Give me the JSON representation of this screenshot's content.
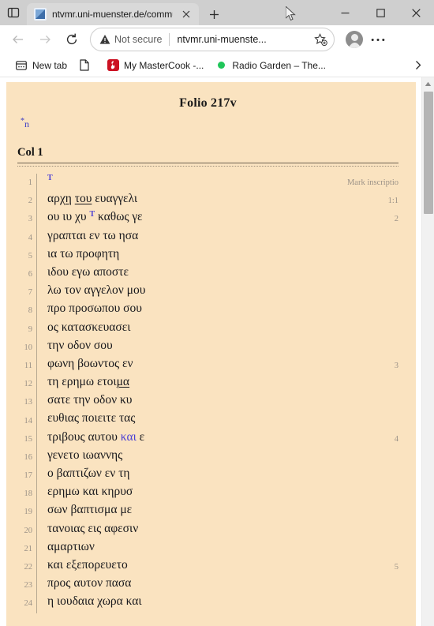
{
  "window": {
    "minimize_label": "Minimize",
    "maximize_label": "Maximize",
    "close_label": "Close"
  },
  "tabstrip": {
    "tab_search_name": "tab-search",
    "tabs": [
      {
        "title": "ntvmr.uni-muenster.de/commun",
        "favicon": "page-icon",
        "close_label": "Close tab"
      }
    ],
    "new_tab_label": "New tab"
  },
  "toolbar": {
    "back_label": "Back",
    "forward_label": "Forward",
    "reload_label": "Refresh",
    "security_text": "Not secure",
    "url": "ntvmr.uni-muenste...",
    "favorite_label": "Add this page to favorites",
    "profile_label": "Profile",
    "settings_label": "Settings and more"
  },
  "bookmarks": {
    "items": [
      {
        "label": "New tab",
        "icon": "new-tab-icon"
      },
      {
        "label": "",
        "icon": "blank-page-icon"
      },
      {
        "label": "My MasterCook -...",
        "icon": "mastercook-favicon",
        "color": "#cc1122"
      },
      {
        "label": "Radio Garden – The...",
        "icon": "radio-garden-favicon",
        "color": "#20c65a"
      }
    ],
    "overflow_label": "Show more bookmarks"
  },
  "content": {
    "folio_title": "Folio 217v",
    "marker_star": "*",
    "marker_n": "n",
    "column_heading": "Col 1",
    "lines": [
      {
        "n": "1",
        "segments": [
          {
            "t": "Τ",
            "s": "mk"
          }
        ],
        "note": "Mark inscriptio"
      },
      {
        "n": "2",
        "segments": [
          {
            "t": "αρχ"
          },
          {
            "t": "η",
            "s": "ul"
          },
          {
            "t": " "
          },
          {
            "t": "του",
            "s": "ul"
          },
          {
            "t": " ευαγγελι"
          }
        ],
        "note": "1:1"
      },
      {
        "n": "3",
        "segments": [
          {
            "t": "ου ιυ χυ "
          },
          {
            "t": "Τ",
            "s": "mk"
          },
          {
            "t": " καθως γε"
          }
        ],
        "note": "2"
      },
      {
        "n": "4",
        "segments": [
          {
            "t": "γραπται εν τω ησα"
          }
        ],
        "note": ""
      },
      {
        "n": "5",
        "segments": [
          {
            "t": "ια τω προφητη"
          }
        ],
        "note": ""
      },
      {
        "n": "6",
        "segments": [
          {
            "t": "ιδου εγω αποστε"
          }
        ],
        "note": ""
      },
      {
        "n": "7",
        "segments": [
          {
            "t": "λω τον αγγελον μου"
          }
        ],
        "note": ""
      },
      {
        "n": "8",
        "segments": [
          {
            "t": "προ προσωπου σου"
          }
        ],
        "note": ""
      },
      {
        "n": "9",
        "segments": [
          {
            "t": "ος κατασκευασει"
          }
        ],
        "note": ""
      },
      {
        "n": "10",
        "segments": [
          {
            "t": "την οδον σου"
          }
        ],
        "note": ""
      },
      {
        "n": "11",
        "segments": [
          {
            "t": "φωνη βοωντος εν"
          }
        ],
        "note": "3"
      },
      {
        "n": "12",
        "segments": [
          {
            "t": "τη ερημω ετοι"
          },
          {
            "t": "μα",
            "s": "ul"
          }
        ],
        "note": ""
      },
      {
        "n": "13",
        "segments": [
          {
            "t": "σατε την οδον κυ"
          }
        ],
        "note": ""
      },
      {
        "n": "14",
        "segments": [
          {
            "t": "ευθιας ποιειτε τας"
          }
        ],
        "note": ""
      },
      {
        "n": "15",
        "segments": [
          {
            "t": "τριβους αυτου "
          },
          {
            "t": "και",
            "s": "hl"
          },
          {
            "t": " ε"
          }
        ],
        "note": "4"
      },
      {
        "n": "16",
        "segments": [
          {
            "t": "γενετο ιωαννης"
          }
        ],
        "note": ""
      },
      {
        "n": "17",
        "segments": [
          {
            "t": "ο βαπτιζων εν τη"
          }
        ],
        "note": ""
      },
      {
        "n": "18",
        "segments": [
          {
            "t": "ερημω και κηρυσ"
          }
        ],
        "note": ""
      },
      {
        "n": "19",
        "segments": [
          {
            "t": "σων βαπτισμα με"
          }
        ],
        "note": ""
      },
      {
        "n": "20",
        "segments": [
          {
            "t": "τανοιας εις αφεσιν"
          }
        ],
        "note": ""
      },
      {
        "n": "21",
        "segments": [
          {
            "t": "αμαρτιων"
          }
        ],
        "note": ""
      },
      {
        "n": "22",
        "segments": [
          {
            "t": "και εξεπορευετο"
          }
        ],
        "note": "5"
      },
      {
        "n": "23",
        "segments": [
          {
            "t": "προς αυτον πασα"
          }
        ],
        "note": ""
      },
      {
        "n": "24",
        "segments": [
          {
            "t": "η ιουδαια χωρα και"
          }
        ],
        "note": ""
      }
    ]
  },
  "colors": {
    "parchment": "#fae3c0",
    "marker_blue": "#4b3fd4",
    "line_number": "#9b9287"
  }
}
